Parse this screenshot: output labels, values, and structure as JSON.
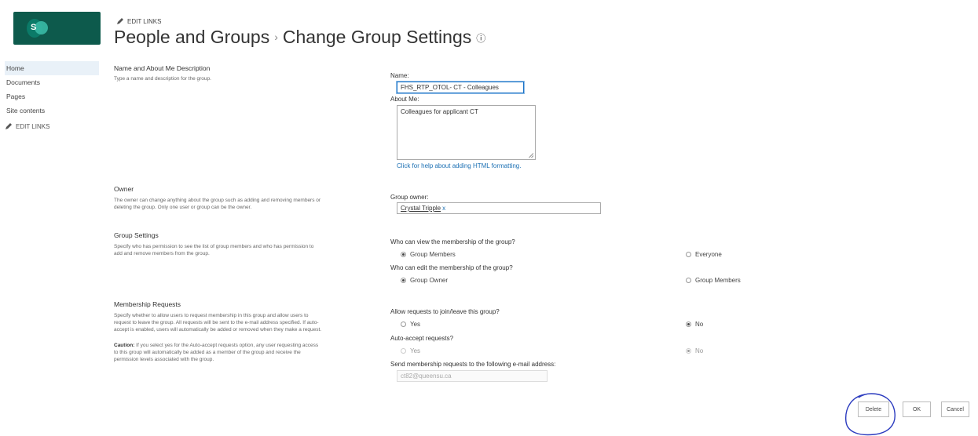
{
  "header": {
    "edit_links": "EDIT LINKS",
    "breadcrumb_root": "People and Groups",
    "breadcrumb_separator": "›",
    "page_title": "Change Group Settings",
    "info_icon": "ⓘ",
    "logo_letter": "S"
  },
  "nav": {
    "items": [
      {
        "label": "Home"
      },
      {
        "label": "Documents"
      },
      {
        "label": "Pages"
      },
      {
        "label": "Site contents"
      }
    ],
    "edit_links": "EDIT LINKS"
  },
  "sections": {
    "name_about": {
      "title": "Name and About Me Description",
      "desc": "Type a name and description for the group.",
      "name_label": "Name:",
      "name_value": "FHS_RTP_OTOL- CT - Colleagues",
      "about_label": "About Me:",
      "about_value": "Colleagues for applicant CT",
      "help_link": "Click for help about adding HTML formatting."
    },
    "owner": {
      "title": "Owner",
      "desc_line1": "The owner can change anything about the group such as adding and removing members or",
      "desc_line2": "deleting the group. Only one user or group can be the owner.",
      "label": "Group owner:",
      "owner_name": "Crystal Tripple",
      "remove_x": "x"
    },
    "group_settings": {
      "title": "Group Settings",
      "desc_line1": "Specify who has permission to see the list of group members and who has permission to",
      "desc_line2": "add and remove members from the group.",
      "view_question": "Who can view the membership of the group?",
      "view_opt1": "Group Members",
      "view_opt2": "Everyone",
      "edit_question": "Who can edit the membership of the group?",
      "edit_opt1": "Group Owner",
      "edit_opt2": "Group Members"
    },
    "membership": {
      "title": "Membership Requests",
      "desc_line1": "Specify whether to allow users to request membership in this group and allow users to",
      "desc_line2": "request to leave the group. All requests will be sent to the e-mail address specified. If auto-",
      "desc_line3": "accept is enabled, users will automatically be added or removed when they make a request.",
      "caution_label": "Caution:",
      "caution_line1": " If you select yes for the Auto-accept requests option, any user requesting access",
      "caution_line2": "to this group will automatically be added as a member of the group and receive the",
      "caution_line3": "permission levels associated with the group.",
      "allow_question": "Allow requests to join/leave this group?",
      "allow_yes": "Yes",
      "allow_no": "No",
      "auto_question": "Auto-accept requests?",
      "auto_yes": "Yes",
      "auto_no": "No",
      "email_label": "Send membership requests to the following e-mail address:",
      "email_value": "ct82@queensu.ca"
    }
  },
  "buttons": {
    "delete": "Delete",
    "ok": "OK",
    "cancel": "Cancel"
  },
  "colors": {
    "logo_bg": "#0d5a4c",
    "link": "#1a6fb3",
    "annotation": "#2b3bbf"
  }
}
